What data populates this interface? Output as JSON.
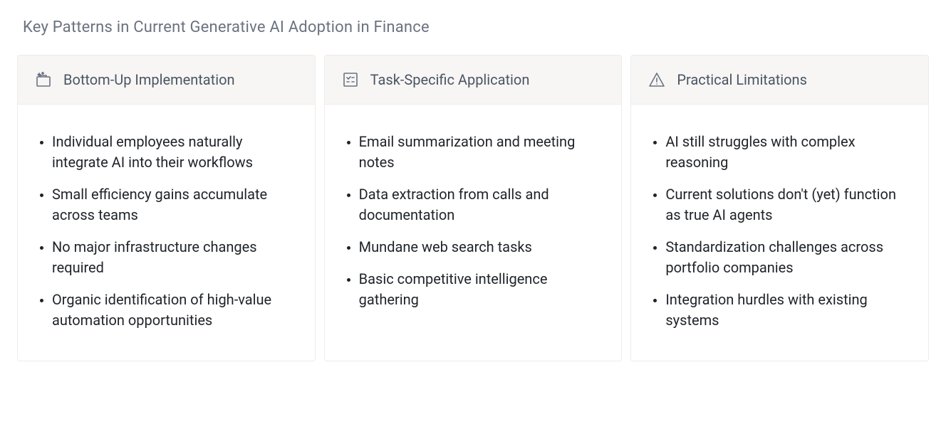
{
  "title": "Key Patterns in Current Generative AI Adoption in Finance",
  "cards": [
    {
      "icon": "sparkle-box-icon",
      "label": "Bottom-Up Implementation",
      "points": [
        "Individual employees naturally integrate AI into their workflows",
        "Small efficiency gains accumulate across teams",
        "No major infrastructure changes required",
        "Organic identification of high-value automation opportunities"
      ]
    },
    {
      "icon": "checklist-icon",
      "label": "Task-Specific Application",
      "points": [
        "Email summarization and meeting notes",
        "Data extraction from calls and documentation",
        "Mundane web search tasks",
        "Basic competitive intelligence gathering"
      ]
    },
    {
      "icon": "warning-icon",
      "label": "Practical Limitations",
      "points": [
        "AI still struggles with complex reasoning",
        "Current solutions don't (yet) function as true AI agents",
        "Standardization challenges across portfolio companies",
        "Integration hurdles with existing systems"
      ]
    }
  ]
}
